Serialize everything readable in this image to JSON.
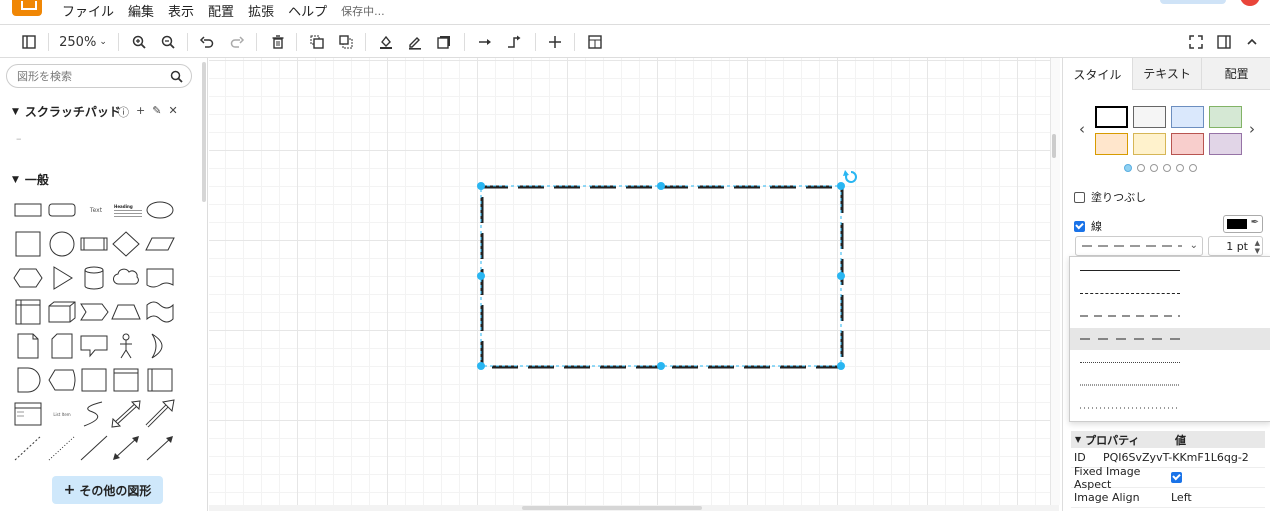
{
  "menubar": {
    "items": [
      "ファイル",
      "編集",
      "表示",
      "配置",
      "拡張",
      "ヘルプ"
    ],
    "save_status": "保存中..."
  },
  "toolbar": {
    "zoom_label": "250%",
    "icons": [
      "format-panel-icon",
      "zoom-in-icon",
      "zoom-out-icon",
      "undo-icon",
      "redo-icon",
      "delete-icon",
      "to-front-icon",
      "to-back-icon",
      "fill-color-icon",
      "line-color-icon",
      "shadow-icon",
      "connection-icon",
      "waypoints-icon",
      "insert-icon",
      "table-icon",
      "fullscreen-icon",
      "toggle-panel-icon",
      "collapse-icon"
    ]
  },
  "sidebar": {
    "search": {
      "placeholder": "図形を検索"
    },
    "scratchpad": {
      "title": "スクラッチパッド",
      "empty_text": "–"
    },
    "general": {
      "title": "一般"
    },
    "shape_texts": {
      "text": "Text",
      "heading": "Heading",
      "list_item": "List Item"
    },
    "more_shapes_label": "その他の図形"
  },
  "panel": {
    "tabs": [
      "スタイル",
      "テキスト",
      "配置"
    ],
    "active_tab": 0,
    "swatches": [
      {
        "fill": "#ffffff",
        "stroke": "#000000"
      },
      {
        "fill": "#f5f5f5",
        "stroke": "#666666"
      },
      {
        "fill": "#dae8fc",
        "stroke": "#6c8ebf"
      },
      {
        "fill": "#d5e8d4",
        "stroke": "#82b366"
      },
      {
        "fill": "#ffe6cc",
        "stroke": "#d79b00"
      },
      {
        "fill": "#fff2cc",
        "stroke": "#d6b656"
      },
      {
        "fill": "#f8cecc",
        "stroke": "#b85450"
      },
      {
        "fill": "#e1d5e7",
        "stroke": "#9673a6"
      }
    ],
    "fill_label": "塗りつぶし",
    "fill_checked": false,
    "line_label": "線",
    "line_checked": true,
    "line_color": "#000000",
    "line_width": "1 pt",
    "line_patterns": [
      "solid",
      "dashed",
      "dashed-long",
      "dashed-longer",
      "dotted",
      "dotted-fine",
      "dotted-sparse"
    ],
    "selected_pattern": 3,
    "properties": {
      "header_name": "プロパティ",
      "header_value": "値",
      "rows": [
        {
          "key": "ID",
          "value": "PQI6SvZyvT-KKmF1L6qg-2"
        },
        {
          "key": "Fixed Image Aspect",
          "value": ""
        },
        {
          "key": "Image Align",
          "value": "Left"
        }
      ]
    }
  },
  "colors": {
    "accent": "#29b6f2",
    "selection": "#00a8ff"
  }
}
